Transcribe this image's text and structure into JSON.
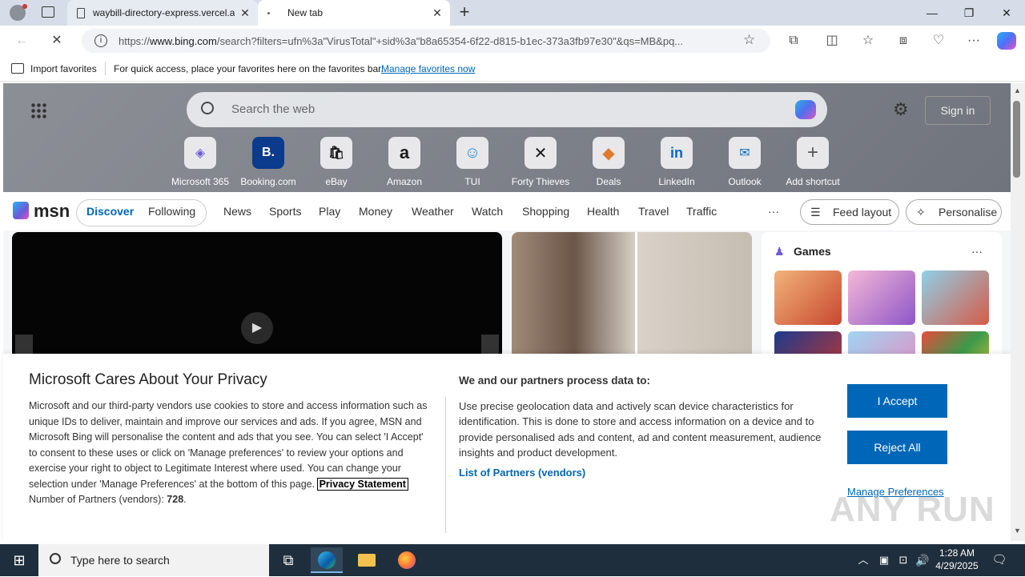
{
  "browser": {
    "tabs": [
      {
        "title": "waybill-directory-express.vercel.a",
        "active": false
      },
      {
        "title": "New tab",
        "active": true
      }
    ],
    "url_prefix": "https://",
    "url_domain": "www.bing.com",
    "url_rest": "/search?filters=ufn%3a\"VirusTotal\"+sid%3a\"b8a65354-6f22-d815-b1ec-373a3fb97e30\"&qs=MB&pq...",
    "favbar": {
      "import_label": "Import favorites",
      "hint": "For quick access, place your favorites here on the favorites bar.",
      "manage_link": "Manage favorites now"
    }
  },
  "msn": {
    "search_placeholder": "Search the web",
    "sign_in": "Sign in",
    "logo": "msn",
    "shortcuts": [
      {
        "label": "Microsoft 365",
        "glyph": "◈",
        "color": "#6b5bd8"
      },
      {
        "label": "Booking.com",
        "glyph": "B.",
        "color": "#0a3b8c"
      },
      {
        "label": "eBay",
        "glyph": "🛍",
        "color": "#e53238"
      },
      {
        "label": "Amazon",
        "glyph": "a",
        "color": "#111111"
      },
      {
        "label": "TUI",
        "glyph": "☺",
        "color": "#1d8fd8"
      },
      {
        "label": "Forty Thieves",
        "glyph": "✕",
        "color": "#222222"
      },
      {
        "label": "Deals",
        "glyph": "◆",
        "color": "#e07a2c"
      },
      {
        "label": "LinkedIn",
        "glyph": "in",
        "color": "#0a66c2"
      },
      {
        "label": "Outlook",
        "glyph": "✉",
        "color": "#0f6cbd"
      },
      {
        "label": "Add shortcut",
        "glyph": "+",
        "color": "#555555"
      }
    ],
    "nav": {
      "discover": "Discover",
      "following": "Following",
      "links": [
        "News",
        "Sports",
        "Play",
        "Money",
        "Weather",
        "Watch",
        "Shopping",
        "Health",
        "Travel",
        "Traffic"
      ],
      "more": "···",
      "feed_layout": "Feed layout",
      "personalise": "Personalise"
    },
    "games_title": "Games",
    "games_more": "···"
  },
  "consent": {
    "title": "Microsoft Cares About Your Privacy",
    "body": "Microsoft and our third-party vendors use cookies to store and access information such as unique IDs to deliver, maintain and improve our services and ads. If you agree, MSN and Microsoft Bing will personalise the content and ads that you see. You can select 'I Accept' to consent to these uses or click on 'Manage preferences' to review your options and exercise your right to object to Legitimate Interest where used.  You can change your selection under 'Manage Preferences' at the bottom of this page.",
    "privacy_link": "Privacy Statement",
    "partners_label": "Number of Partners (vendors):",
    "partners_count": "728",
    "right_title": "We and our partners process data to:",
    "right_body": "Use precise geolocation data and actively scan device characteristics for identification. This is done to store and access information on a device and to provide personalised ads and content, ad and content measurement, audience insights and product development.",
    "partners_link": "List of Partners (vendors)",
    "accept": "I Accept",
    "reject": "Reject All",
    "manage": "Manage Preferences"
  },
  "taskbar": {
    "search_placeholder": "Type here to search",
    "time": "1:28 AM",
    "date": "4/29/2025"
  },
  "watermark": "ANY RUN"
}
